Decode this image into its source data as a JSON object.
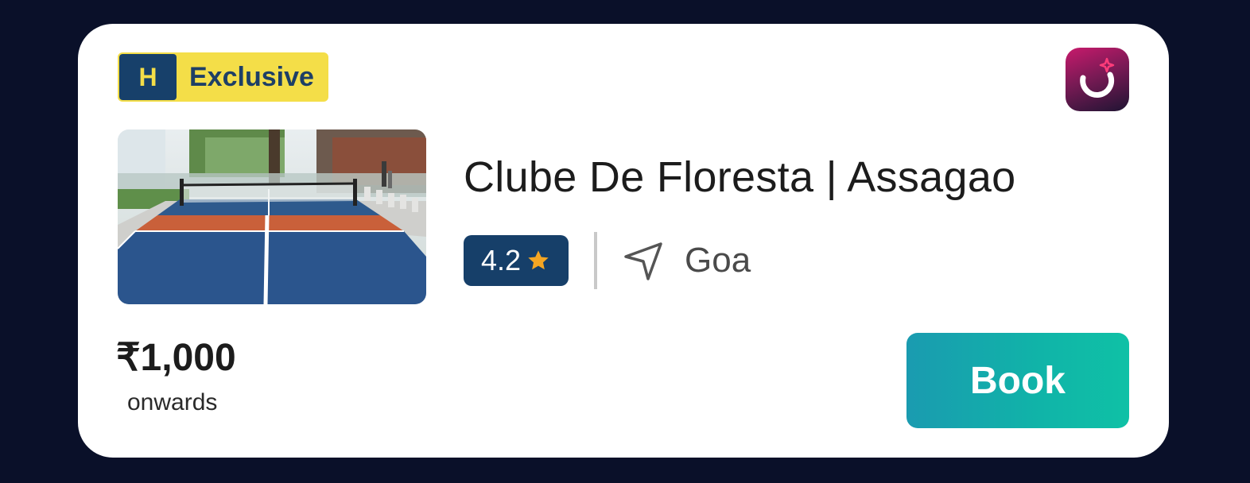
{
  "badge": {
    "letter": "H",
    "label": "Exclusive"
  },
  "venue": {
    "name": "Clube De Floresta | Assagao",
    "rating": "4.2",
    "location": "Goa"
  },
  "price": {
    "amount": "₹1,000",
    "suffix": "onwards"
  },
  "actions": {
    "book_label": "Book"
  },
  "icons": {
    "star": "star-icon",
    "location": "navigation-arrow-icon",
    "app": "app-logo"
  },
  "colors": {
    "background": "#0a1029",
    "badge_yellow": "#f4de48",
    "badge_navy": "#17406a",
    "rating_bg": "#163f69",
    "star": "#f5a623",
    "book_gradient_start": "#1a9bb0",
    "book_gradient_end": "#0fc1a6"
  }
}
